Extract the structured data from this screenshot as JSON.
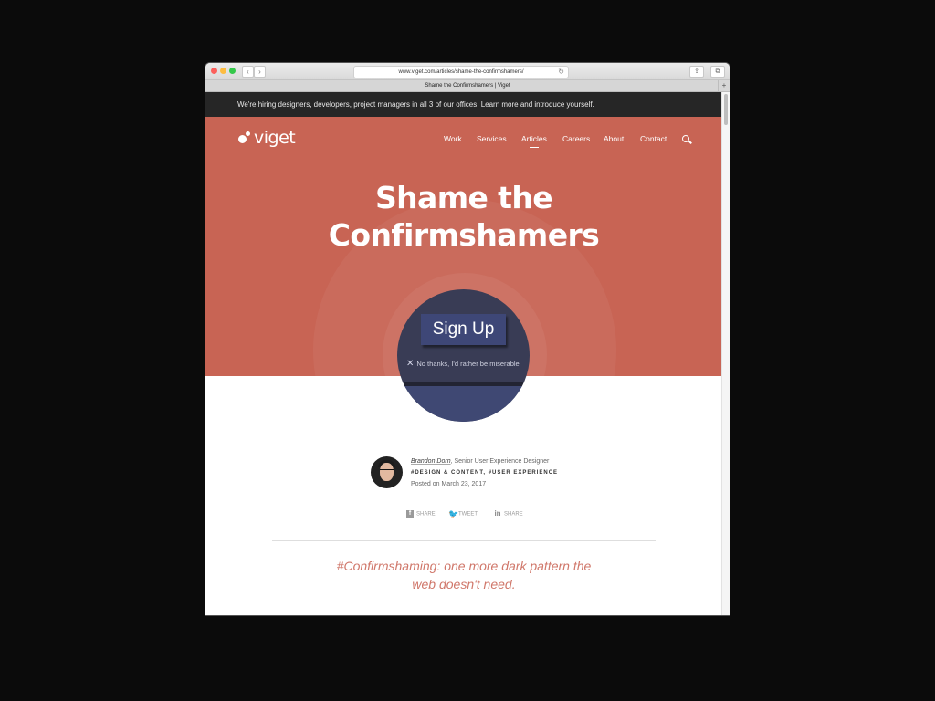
{
  "browser": {
    "url": "www.viget.com/articles/shame-the-confirmshamers/",
    "tab_title": "Shame the Confirmshamers | Viget",
    "back_icon": "‹",
    "forward_icon": "›",
    "reload_icon": "↻",
    "share_icon": "⇪",
    "tabs_icon": "⧉",
    "new_tab_icon": "+"
  },
  "banner": {
    "text": "We're hiring designers, developers, project managers in all 3 of our offices. Learn more and introduce yourself."
  },
  "header": {
    "logo": "viget",
    "nav": [
      "Work",
      "Services",
      "Articles",
      "Careers",
      "About",
      "Contact"
    ],
    "active_nav": "Articles"
  },
  "hero": {
    "title_line1": "Shame the",
    "title_line2": "Confirmshamers",
    "signup_label": "Sign Up",
    "decline_icon": "✕",
    "decline_text": "No thanks, I'd rather be miserable"
  },
  "author": {
    "name": "Brandon Dorn",
    "role": ", Senior User Experience Designer",
    "tag1": "#DESIGN & CONTENT",
    "tag2": "#USER EXPERIENCE",
    "posted": "Posted on March 23, 2017"
  },
  "share": {
    "facebook_icon": "f",
    "facebook_label": "SHARE",
    "twitter_icon": "🐦",
    "twitter_label": "TWEET",
    "linkedin_icon": "in",
    "linkedin_label": "SHARE"
  },
  "article": {
    "pullquote_line1": "#Confirmshaming: one more dark pattern the",
    "pullquote_line2": "web doesn't need."
  }
}
